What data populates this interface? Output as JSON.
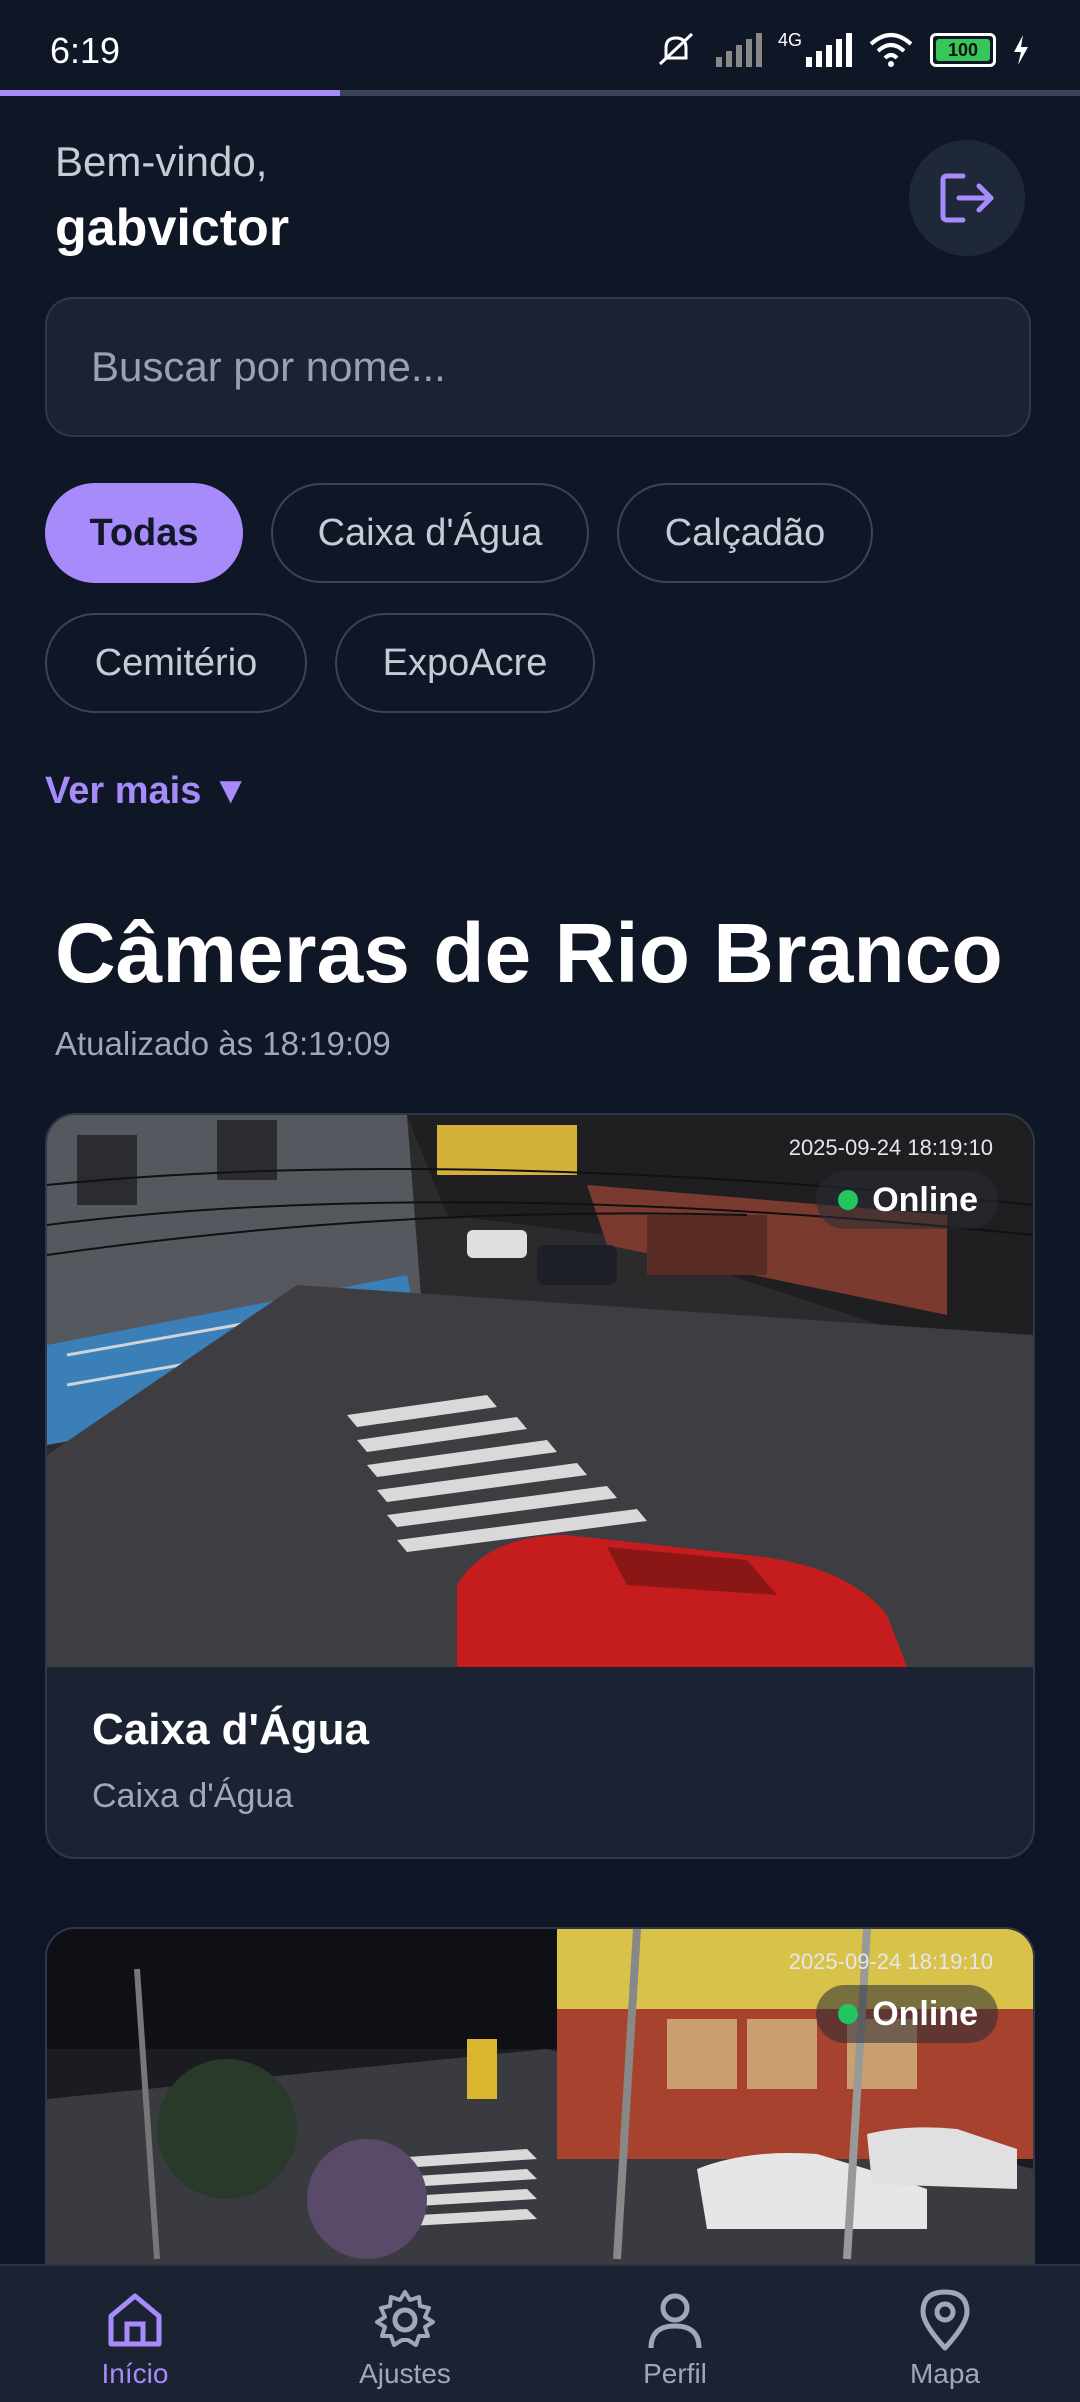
{
  "status": {
    "time": "6:19",
    "network": "4G",
    "battery": "100"
  },
  "progress": {
    "fraction": 0.315
  },
  "header": {
    "welcome": "Bem-vindo,",
    "username": "gabvictor",
    "logout_icon": "logout-icon"
  },
  "search": {
    "placeholder": "Buscar por nome..."
  },
  "filters": {
    "chips": [
      "Todas",
      "Caixa d'Água",
      "Calçadão",
      "Cemitério",
      "ExpoAcre"
    ],
    "active": "Todas",
    "more": "Ver mais ▼"
  },
  "section": {
    "title": "Câmeras de Rio Branco",
    "updated": "Atualizado às 18:19:09"
  },
  "cameras": [
    {
      "timestamp": "2025-09-24 18:19:10",
      "status": "Online",
      "title": "Caixa d'Água",
      "subtitle": "Caixa d'Água"
    },
    {
      "timestamp": "2025-09-24 18:19:10",
      "status": "Online",
      "title": "",
      "subtitle": ""
    }
  ],
  "nav": {
    "items": [
      {
        "label": "Início",
        "icon": "home-icon"
      },
      {
        "label": "Ajustes",
        "icon": "gear-icon"
      },
      {
        "label": "Perfil",
        "icon": "user-icon"
      },
      {
        "label": "Mapa",
        "icon": "map-pin-icon"
      }
    ]
  },
  "colors": {
    "accent": "#a78bfa",
    "background": "#0f1726",
    "online": "#22c55e"
  }
}
